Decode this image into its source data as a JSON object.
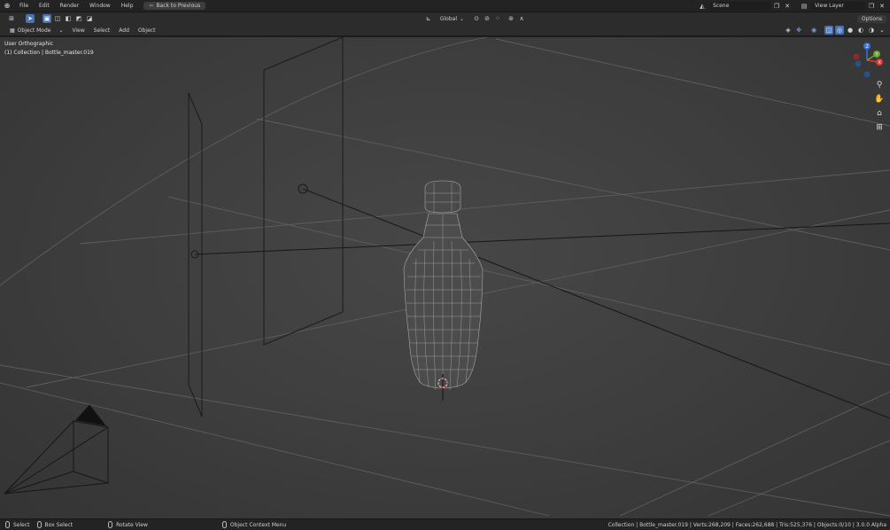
{
  "topbar": {
    "menus": [
      "File",
      "Edit",
      "Render",
      "Window",
      "Help"
    ],
    "back_button": "Back to Previous",
    "scene": "Scene",
    "view_layer": "View Layer"
  },
  "toolbar": {
    "transform_orientation": "Global",
    "options": "Options"
  },
  "header": {
    "mode": "Object Mode",
    "menus": [
      "View",
      "Select",
      "Add",
      "Object"
    ]
  },
  "viewport": {
    "view_name": "User Orthographic",
    "collection_info": "(1) Collection | Bottle_master.019",
    "gizmo_axes": [
      "X",
      "Y",
      "Z"
    ]
  },
  "statusbar": {
    "select": "Select",
    "box_select": "Box Select",
    "rotate_view": "Rotate View",
    "context_menu": "Object Context Menu",
    "stats": "Collection | Bottle_master.019 | Verts:268,209 | Faces:262,688 | Tris:525,376 | Objects:0/10 | 3.0.0 Alpha"
  },
  "colors": {
    "accent": "#4772b3",
    "x_axis": "#e0353a",
    "y_axis": "#66a832",
    "z_axis": "#3b6fd8"
  }
}
